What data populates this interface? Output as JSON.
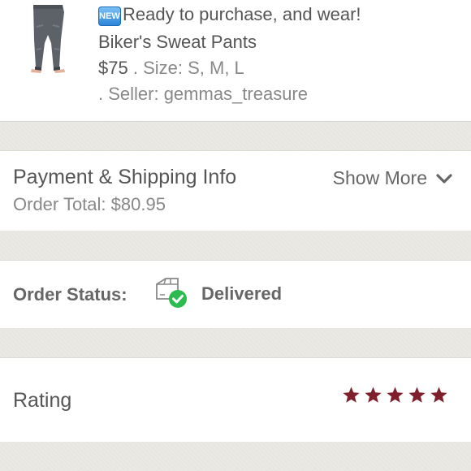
{
  "product": {
    "badge": "NEW",
    "headline": "Ready to purchase, and wear!",
    "name": "Biker's Sweat Pants",
    "price": "$75",
    "size_text": ". Size: S, M, L",
    "seller_text": ". Seller: gemmas_treasure"
  },
  "payment": {
    "title": "Payment & Shipping Info",
    "order_total": "Order Total: $80.95",
    "show_more": "Show More"
  },
  "order_status": {
    "label": "Order Status:",
    "value": "Delivered"
  },
  "rating": {
    "label": "Rating",
    "stars": 5,
    "star_color": "#7f1f2b"
  },
  "colors": {
    "check_green": "#2dba4e",
    "background": "#e9e7e2"
  }
}
